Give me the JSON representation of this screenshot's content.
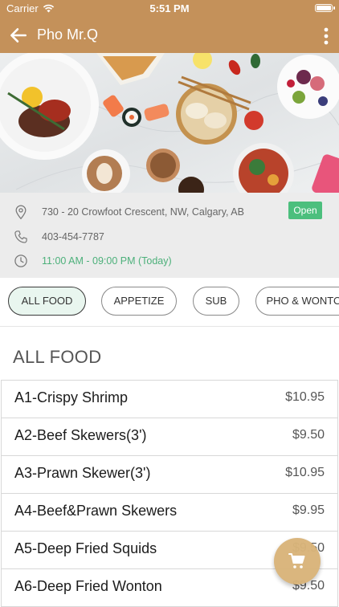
{
  "status_bar": {
    "carrier": "Carrier",
    "time": "5:51 PM"
  },
  "app_bar": {
    "title": "Pho Mr.Q",
    "back_icon": "arrow-left-icon",
    "menu_icon": "more-vertical-icon"
  },
  "restaurant": {
    "address": "730 - 20 Crowfoot Crescent, NW, Calgary, AB",
    "phone": "403-454-7787",
    "hours": "11:00 AM - 09:00 PM (Today)",
    "status": "Open"
  },
  "categories": {
    "all": "ALL FOOD",
    "appetize": "APPETIZE",
    "sub": "SUB",
    "pho": "PHO & WONTON"
  },
  "section_title": "ALL FOOD",
  "menu_items": [
    {
      "name": "A1-Crispy Shrimp",
      "price": "$10.95"
    },
    {
      "name": "A2-Beef Skewers(3')",
      "price": "$9.50"
    },
    {
      "name": "A3-Prawn Skewer(3')",
      "price": "$10.95"
    },
    {
      "name": "A4-Beef&Prawn Skewers",
      "price": "$9.95"
    },
    {
      "name": "A5-Deep Fried Squids",
      "price": "$9.50"
    },
    {
      "name": "A6-Deep Fried Wonton",
      "price": "$9.50"
    }
  ],
  "colors": {
    "primary": "#c4915a",
    "open_green": "#4cbf7d",
    "hours_green": "#4cb07a",
    "fab": "#d9b47a"
  }
}
